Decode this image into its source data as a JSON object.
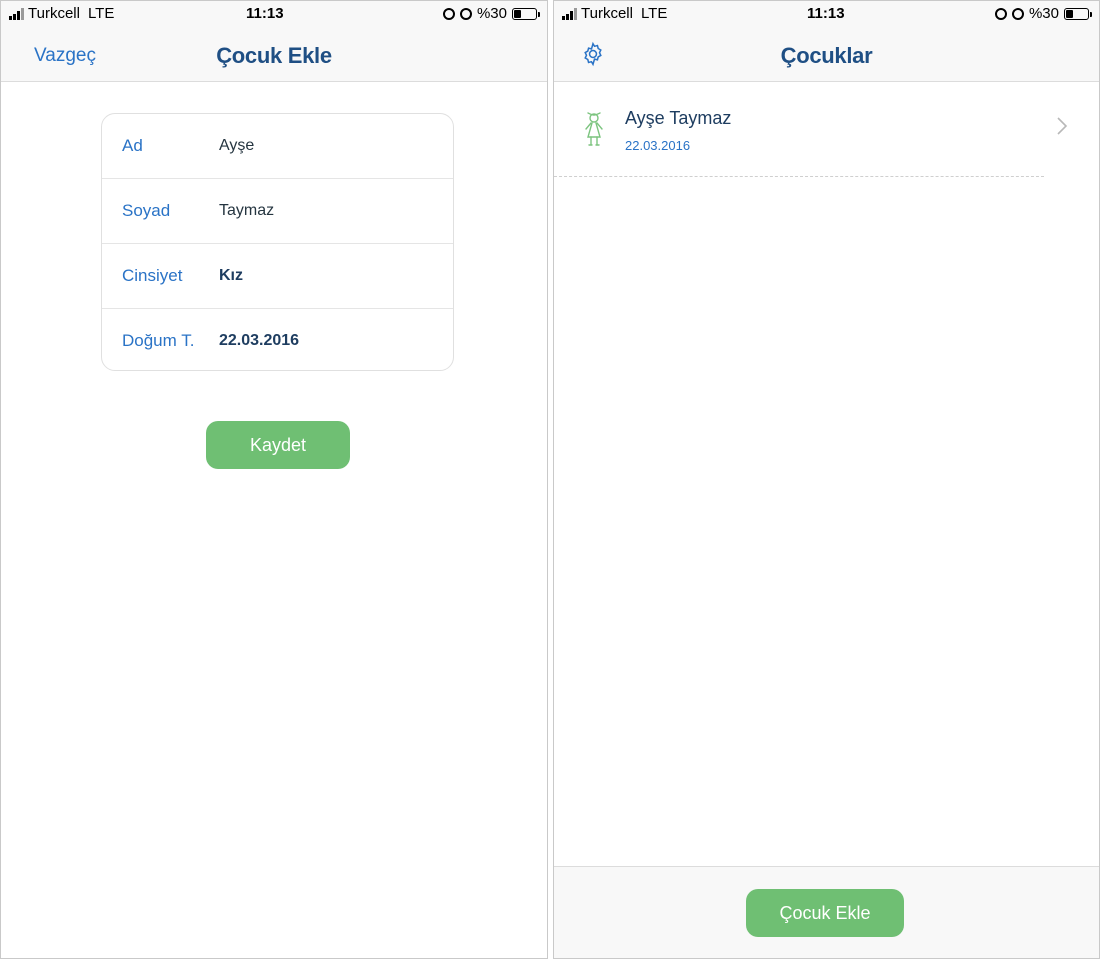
{
  "status_bar": {
    "carrier": "Turkcell",
    "network": "LTE",
    "time": "11:13",
    "battery": "%30",
    "battery_level": 0.3
  },
  "add_child_screen": {
    "cancel_label": "Vazgeç",
    "title": "Çocuk Ekle",
    "fields": [
      {
        "label": "Ad",
        "value": "Ayşe"
      },
      {
        "label": "Soyad",
        "value": "Taymaz"
      },
      {
        "label": "Cinsiyet",
        "value": "Kız"
      },
      {
        "label": "Doğum T.",
        "value": "22.03.2016"
      }
    ],
    "save_label": "Kaydet"
  },
  "children_screen": {
    "title": "Çocuklar",
    "settings_icon": "gear-icon",
    "children": [
      {
        "name": "Ayşe Taymaz",
        "birth_date": "22.03.2016",
        "icon": "girl-icon"
      }
    ],
    "add_label": "Çocuk Ekle"
  },
  "colors": {
    "accent_blue": "#2a73c6",
    "title_navy": "#1f4f84",
    "button_green": "#6fbf73",
    "icon_green": "#7cc47f"
  }
}
